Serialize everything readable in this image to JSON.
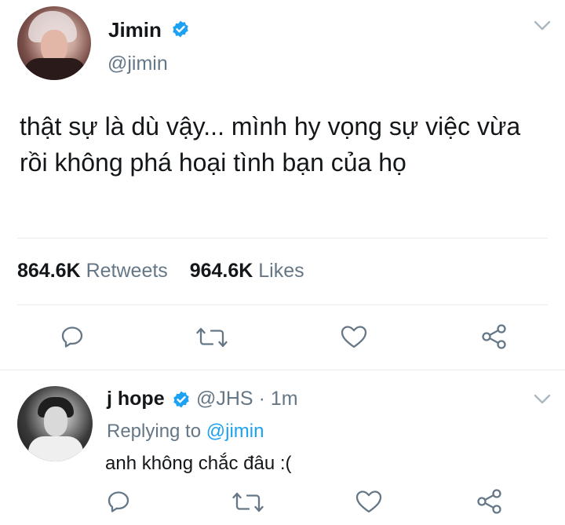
{
  "main_tweet": {
    "author_name": "Jimin",
    "author_handle": "@jimin",
    "text": "thật sự là dù vậy... mình hy vọng sự việc vừa rồi không phá hoại tình bạn của họ",
    "retweet_count": "864.6K",
    "retweet_label": "Retweets",
    "like_count": "964.6K",
    "like_label": "Likes"
  },
  "reply_tweet": {
    "author_name": "j hope",
    "author_handle": "@JHS",
    "separator": "·",
    "time": "1m",
    "replying_prefix": "Replying to",
    "replying_to": "@jimin",
    "text": "anh không chắc đâu :("
  },
  "colors": {
    "primary_text": "#14171a",
    "secondary_text": "#657786",
    "link_blue": "#1da1f2",
    "verified_blue": "#1da1f2",
    "divider": "#e6ecf0"
  },
  "icons": [
    "verified-badge-icon",
    "chevron-down-icon",
    "reply-icon",
    "retweet-icon",
    "like-icon",
    "share-icon"
  ]
}
